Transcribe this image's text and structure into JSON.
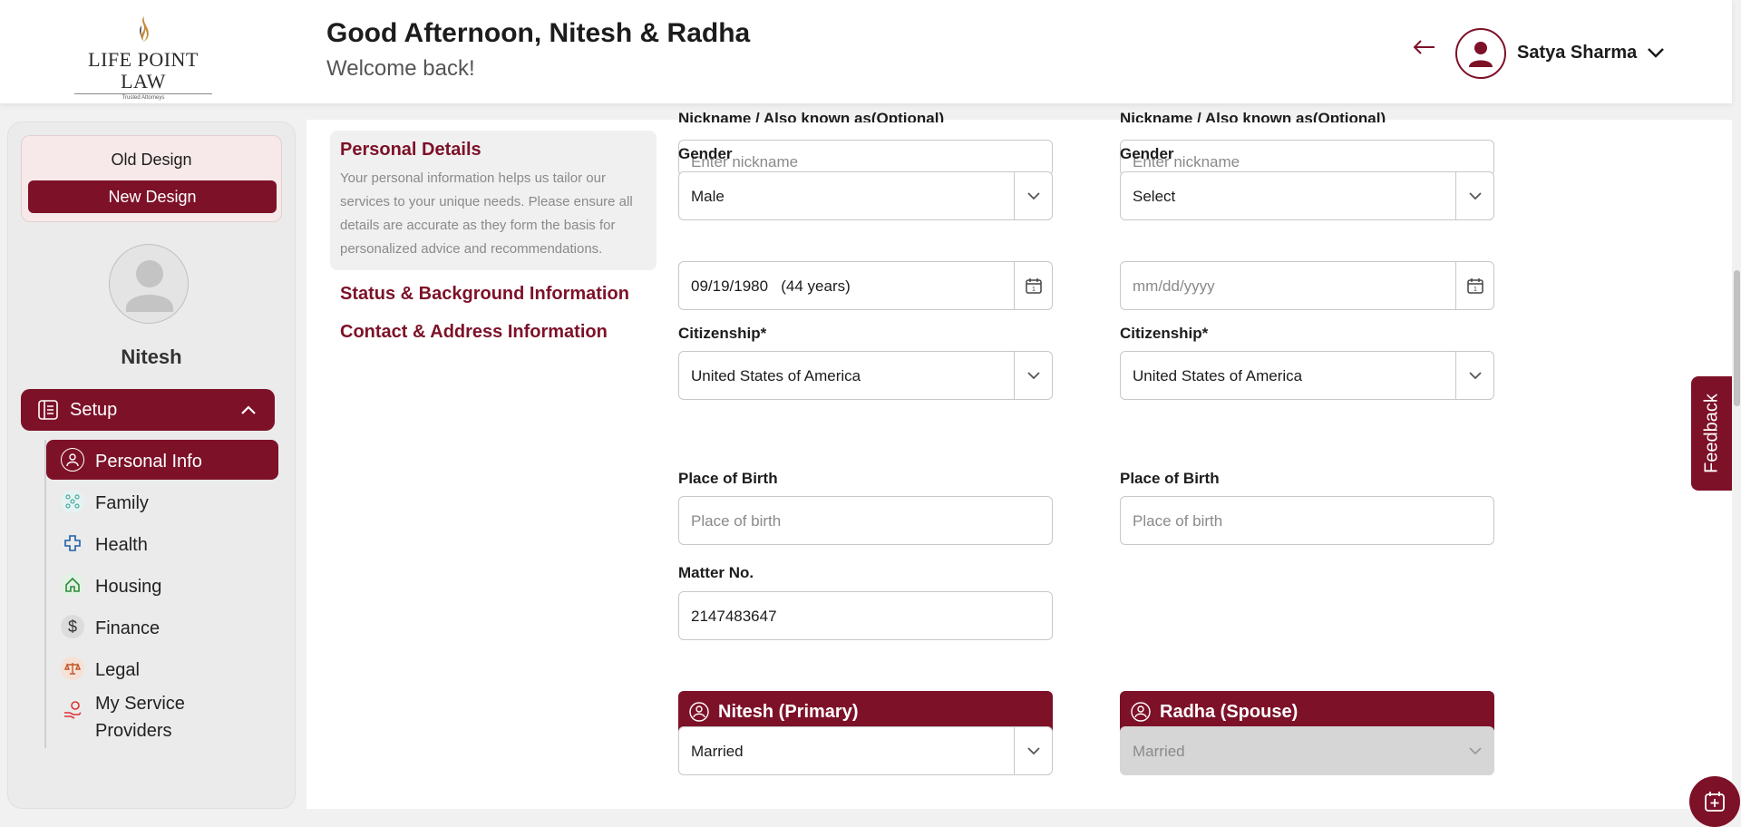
{
  "header": {
    "logo_text": "LIFE POINT LAW",
    "logo_tagline": "Trusted Attorneys",
    "greeting": "Good Afternoon, Nitesh & Radha",
    "welcome": "Welcome back!",
    "user_name": "Satya Sharma",
    "back_icon": "arrow-left-icon",
    "avatar_icon": "user-icon"
  },
  "sidebar": {
    "old_design": "Old Design",
    "new_design": "New Design",
    "profile_name": "Nitesh",
    "setup_label": "Setup",
    "items": [
      {
        "label": "Personal Info",
        "icon": "user-circle-icon",
        "active": true
      },
      {
        "label": "Family",
        "icon": "family-tree-icon"
      },
      {
        "label": "Health",
        "icon": "medical-cross-icon"
      },
      {
        "label": "Housing",
        "icon": "home-icon"
      },
      {
        "label": "Finance",
        "icon": "dollar-icon"
      },
      {
        "label": "Legal",
        "icon": "scales-icon"
      },
      {
        "label": "My Service Providers",
        "label_line1": "My Service",
        "label_line2": "Providers",
        "icon": "service-hand-icon"
      }
    ]
  },
  "sections": {
    "active_title": "Personal Details",
    "active_description": "Your personal information helps us tailor our services to your unique needs. Please ensure all details are accurate as they form the basis for personalized advice and recommendations.",
    "links": [
      "Status & Background Information",
      "Contact & Address Information"
    ]
  },
  "form": {
    "nickname_label": "Nickname / Also known as(Optional)",
    "nickname_placeholder": "Enter nickname",
    "gender_label": "Gender",
    "citizenship_label": "Citizenship*",
    "place_of_birth_label": "Place of Birth",
    "place_of_birth_placeholder": "Place of birth",
    "matter_label": "Matter No.",
    "primary": {
      "gender": "Male",
      "dob": "09/19/1980",
      "age": "(44 years)",
      "citizenship": "United States of America",
      "matter_no": "2147483647",
      "bar_name": "Nitesh (Primary)",
      "marital_status": "Married"
    },
    "spouse": {
      "gender": "Select",
      "dob_placeholder": "mm/dd/yyyy",
      "citizenship": "United States of America",
      "bar_name": "Radha (Spouse)",
      "marital_status": "Married"
    }
  },
  "feedback_label": "Feedback",
  "colors": {
    "brand": "#7d1128"
  }
}
